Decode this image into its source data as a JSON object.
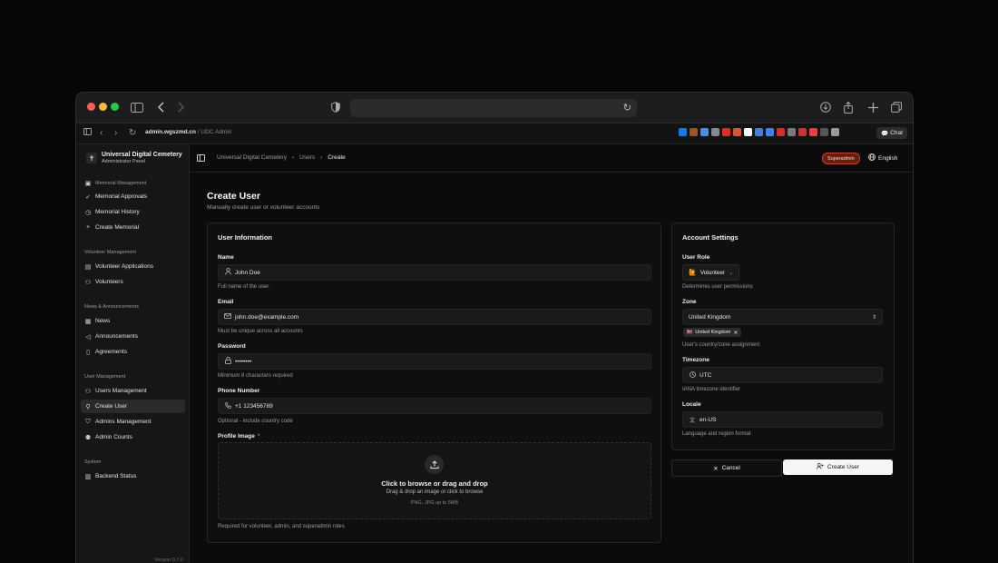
{
  "browser": {
    "tab_url_domain": "admin.wgszmd.cn",
    "tab_url_rest": " / UDC Admin",
    "chat_label": "Chat",
    "extension_colors": [
      "#1877f2",
      "#a0522d",
      "#4a90e2",
      "#888888",
      "#d93025",
      "#e0533b",
      "#ffffff",
      "#4a7bd8",
      "#3b82f6",
      "#d32f2f",
      "#7a7a7a",
      "#cc3333",
      "#e04545",
      "#555555",
      "#9a9a9a"
    ]
  },
  "sidebar": {
    "brand_title": "Universal Digital Cemetery",
    "brand_subtitle": "Administrator Panel",
    "sections": [
      {
        "title": "Memorial Management",
        "items": [
          {
            "label": "Memorial Approvals",
            "icon": "check-circle-icon"
          },
          {
            "label": "Memorial History",
            "icon": "clock-icon"
          },
          {
            "label": "Create Memorial",
            "icon": "plus-icon"
          }
        ]
      },
      {
        "title": "Volunteer Management",
        "items": [
          {
            "label": "Volunteer Applications",
            "icon": "clipboard-icon"
          },
          {
            "label": "Volunteers",
            "icon": "users-icon"
          }
        ]
      },
      {
        "title": "News & Announcements",
        "items": [
          {
            "label": "News",
            "icon": "newspaper-icon"
          },
          {
            "label": "Announcements",
            "icon": "megaphone-icon"
          },
          {
            "label": "Agreements",
            "icon": "document-icon"
          }
        ]
      },
      {
        "title": "User Management",
        "items": [
          {
            "label": "Users Management",
            "icon": "users-icon"
          },
          {
            "label": "Create User",
            "icon": "user-plus-icon"
          },
          {
            "label": "Admins Management",
            "icon": "shield-icon"
          },
          {
            "label": "Admin Counts",
            "icon": "user-count-icon"
          }
        ]
      },
      {
        "title": "System",
        "items": [
          {
            "label": "Backend Status",
            "icon": "server-icon"
          }
        ]
      }
    ],
    "version": "Version 0.7.0"
  },
  "header": {
    "breadcrumbs": [
      "Universal Digital Cemetery",
      "Users",
      "Create"
    ],
    "role_badge": "Superadmin",
    "language": "English"
  },
  "page": {
    "title": "Create User",
    "subtitle": "Manually create user or volunteer accounts"
  },
  "user_info": {
    "title": "User Information",
    "name_label": "Name",
    "name_placeholder": "John Doe",
    "name_hint": "Full name of the user",
    "email_label": "Email",
    "email_placeholder": "john.doe@example.com",
    "email_hint": "Must be unique across all accounts",
    "password_label": "Password",
    "password_placeholder": "••••••••",
    "password_hint": "Minimum 8 characters required",
    "phone_label": "Phone Number",
    "phone_placeholder": "+1 123456789",
    "phone_hint": "Optional - include country code",
    "image_label": "Profile Image",
    "required_mark": "*",
    "dropzone_title": "Click to browse or drag and drop",
    "dropzone_sub": "Drag & drop an image or click to browse",
    "dropzone_formats": "PNG, JPG up to 5MB",
    "image_hint": "Required for volunteer, admin, and superadmin roles"
  },
  "account": {
    "title": "Account Settings",
    "role_label": "User Role",
    "role_value": "Volunteer",
    "role_hint": "Determines user permissions",
    "zone_label": "Zone",
    "zone_value": "United Kingdom",
    "zone_chip": "United Kingdom",
    "zone_hint": "User's country/zone assignment",
    "timezone_label": "Timezone",
    "timezone_value": "UTC",
    "timezone_hint": "IANA timezone identifier",
    "locale_label": "Locale",
    "locale_value": "en-US",
    "locale_hint": "Language and region format"
  },
  "actions": {
    "cancel": "Cancel",
    "create": "Create User"
  }
}
